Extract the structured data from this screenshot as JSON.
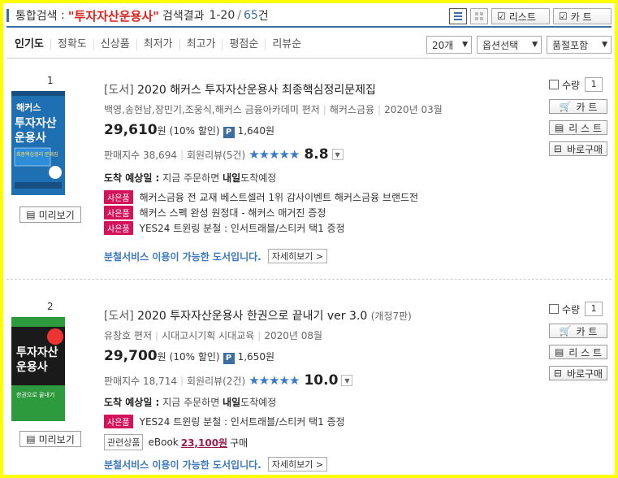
{
  "header": {
    "label": "통합검색",
    "query": "\"투자자산운용사\"",
    "result_label": "검색결과",
    "range": "1-20",
    "slash": "/",
    "total": "65",
    "total_unit": "건",
    "list_button": "리스트",
    "cart_button": "카 트"
  },
  "sort": {
    "options": [
      "인기도",
      "정확도",
      "신상품",
      "최저가",
      "최고가",
      "평점순",
      "리뷰순"
    ],
    "per_page": "20개",
    "option_select": "옵션선택",
    "stock_filter": "품절포함"
  },
  "items": [
    {
      "rank": "1",
      "category": "[도서]",
      "title": "2020 해커스 투자자산운용사 최종핵심정리문제집",
      "edition": "",
      "authors": "백영,송현남,장민기,조웅식,해커스 금융아카데미 편저",
      "publisher": "해커스금융",
      "date": "2020년 03월",
      "price": "29,610",
      "price_unit": "원",
      "discount": "(10% 할인)",
      "point_badge": "P",
      "points": "1,640원",
      "sales_label": "판매지수 38,694",
      "review_label": "회원리뷰(5건)",
      "stars": "★★★★★",
      "rating": "8.8",
      "arrival_label": "도착 예상일 :",
      "arrival_prefix": "지금 주문하면",
      "arrival_day": "내일",
      "arrival_suffix": "도착예정",
      "gift_badge": "사은품",
      "gifts": [
        "해커스금융 전 교재 베스트셀러 1위 감사이벤트 해커스금융 브랜드전",
        "해커스 스펙 완성 원정대 - 해커스 매거진 증정",
        "YES24 트윈링 분철 : 인서트래블/스티커 택1 증정"
      ],
      "split_service": "분철서비스 이용이 가능한 도서입니다.",
      "detail_button": "자세히보기",
      "preview_button": "미리보기",
      "qty_label": "수량",
      "qty": "1",
      "cart_button": "카 트",
      "list_button": "리 스 트",
      "buy_button": "바로구매",
      "cover": {
        "brand": "해커스",
        "title1": "투자자산",
        "title2": "운용사",
        "sub": "최종핵심정리 문제집",
        "color": "#1f6fb3"
      }
    },
    {
      "rank": "2",
      "category": "[도서]",
      "title": "2020 투자자산운용사 한권으로 끝내기 ver 3.0",
      "edition": "(개정7판)",
      "authors": "유창호 편저",
      "publisher": "시대고시기획 시대교육",
      "date": "2020년 08월",
      "price": "29,700",
      "price_unit": "원",
      "discount": "(10% 할인)",
      "point_badge": "P",
      "points": "1,650원",
      "sales_label": "판매지수 18,714",
      "review_label": "회원리뷰(2건)",
      "stars": "★★★★★",
      "rating": "10.0",
      "arrival_label": "도착 예상일 :",
      "arrival_prefix": "지금 주문하면",
      "arrival_day": "내일",
      "arrival_suffix": "도착예정",
      "gift_badge": "사은품",
      "gifts": [
        "YES24 트윈링 분철 : 인서트래블/스티커 택1 증정"
      ],
      "related_badge": "관련상품",
      "ebook_label": "eBook",
      "ebook_price": "23,100원",
      "ebook_suffix": "구매",
      "split_service": "분철서비스 이용이 가능한 도서입니다.",
      "detail_button": "자세히보기",
      "preview_button": "미리보기",
      "qty_label": "수량",
      "qty": "1",
      "cart_button": "카 트",
      "list_button": "리 스 트",
      "buy_button": "바로구매",
      "cover": {
        "title1": "투자자산",
        "title2": "운용사",
        "sub": "한권으로 끝내기",
        "color": "#1a1a1a",
        "accent": "#2e9a3e"
      }
    }
  ]
}
